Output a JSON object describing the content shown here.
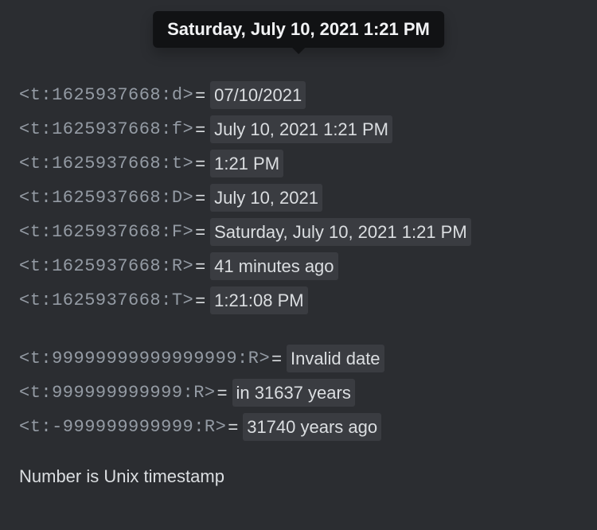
{
  "tooltip": {
    "text": "Saturday, July 10, 2021 1:21 PM"
  },
  "rows": [
    {
      "code": "<t:1625937668:d>",
      "equals": " = ",
      "output": "07/10/2021"
    },
    {
      "code": "<t:1625937668:f>",
      "equals": " = ",
      "output": "July 10, 2021 1:21 PM"
    },
    {
      "code": "<t:1625937668:t>",
      "equals": " = ",
      "output": "1:21 PM"
    },
    {
      "code": "<t:1625937668:D>",
      "equals": " = ",
      "output": "July 10, 2021"
    },
    {
      "code": "<t:1625937668:F>",
      "equals": " = ",
      "output": "Saturday, July 10, 2021 1:21 PM"
    },
    {
      "code": "<t:1625937668:R>",
      "equals": " = ",
      "output": "41 minutes ago"
    },
    {
      "code": "<t:1625937668:T>",
      "equals": " = ",
      "output": "1:21:08 PM"
    }
  ],
  "rows2": [
    {
      "code": "<t:99999999999999999:R>",
      "equals": "  =  ",
      "output": "Invalid date"
    },
    {
      "code": "<t:999999999999:R>",
      "equals": "  =  ",
      "output": "in 31637 years"
    },
    {
      "code": "<t:-999999999999:R>",
      "equals": "  =  ",
      "output": "31740 years ago"
    }
  ],
  "footer": {
    "text": "Number is Unix timestamp"
  }
}
